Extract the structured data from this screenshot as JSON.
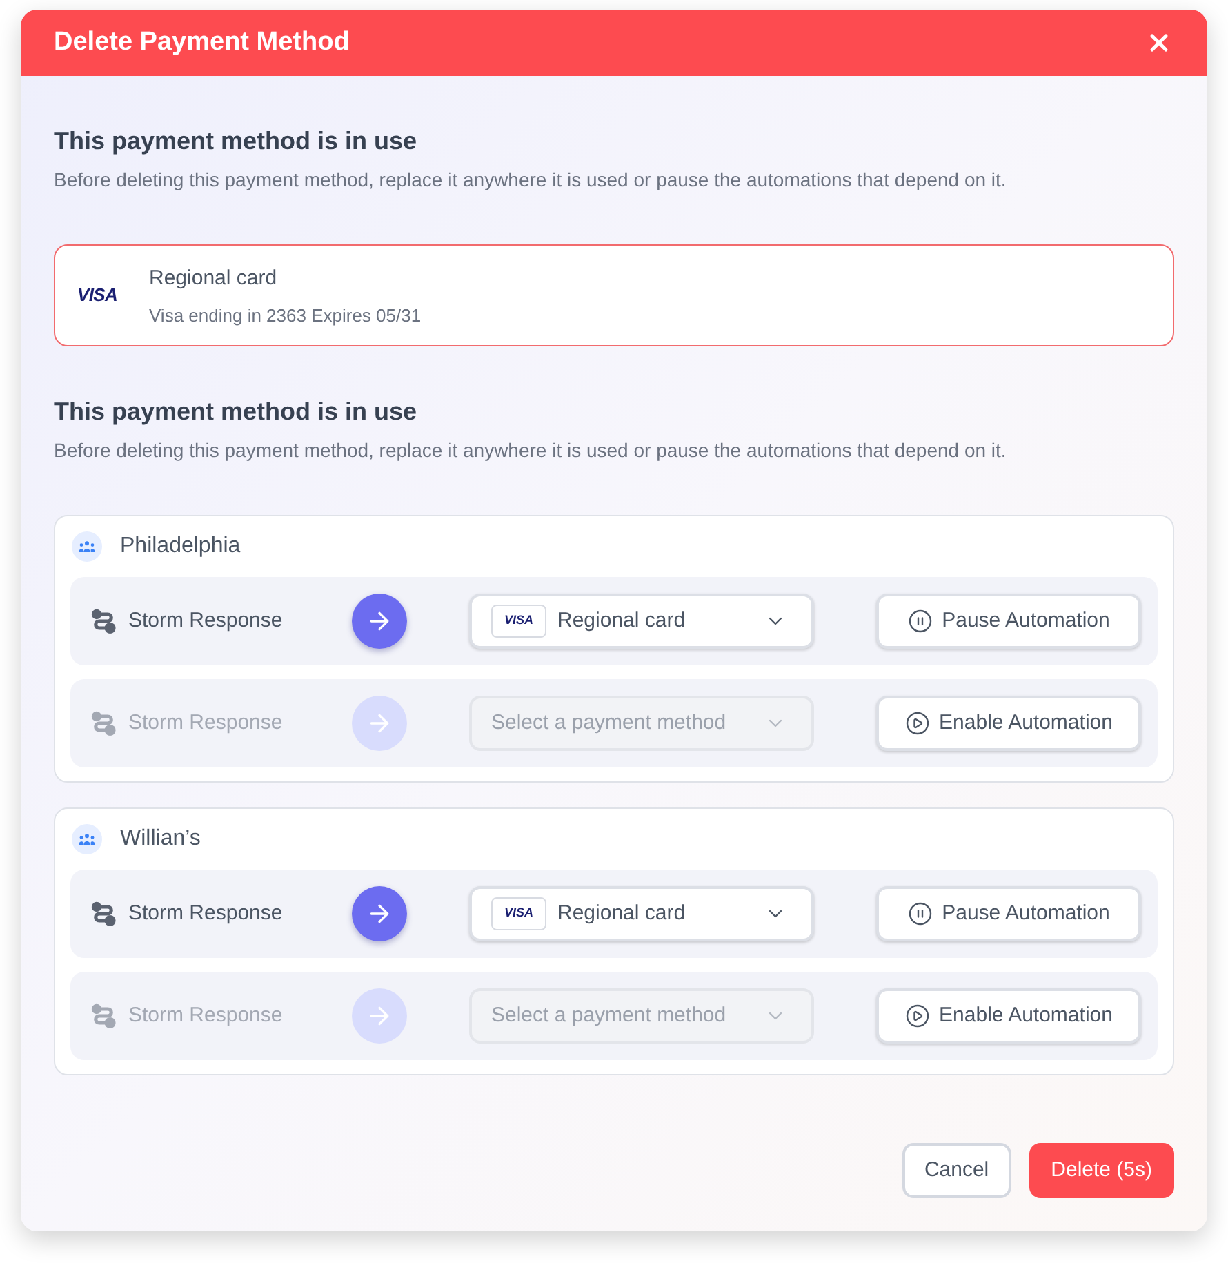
{
  "dialog": {
    "title": "Delete Payment Method"
  },
  "notice": {
    "heading": "This payment method is in use",
    "description": "Before deleting this payment method, replace it anywhere it is used or pause the automations that depend on it."
  },
  "payment_method": {
    "brand": "VISA",
    "name": "Regional card",
    "details": "Visa ending in 2363 Expires 05/31"
  },
  "replace_notice": {
    "heading": "This payment method is in use",
    "description": "Before deleting this payment method, replace it anywhere it is used or pause the automations that depend on it."
  },
  "groups": [
    {
      "name": "Philadelphia",
      "automations": [
        {
          "name": "Storm Response",
          "disabled": false,
          "select": {
            "brand": "VISA",
            "value": "Regional card"
          },
          "action": {
            "kind": "pause",
            "label": "Pause Automation"
          }
        },
        {
          "name": "Storm Response",
          "disabled": true,
          "select": {
            "placeholder": "Select a payment method"
          },
          "action": {
            "kind": "enable",
            "label": "Enable Automation"
          }
        }
      ]
    },
    {
      "name": "Willian’s",
      "automations": [
        {
          "name": "Storm Response",
          "disabled": false,
          "select": {
            "brand": "VISA",
            "value": "Regional card"
          },
          "action": {
            "kind": "pause",
            "label": "Pause Automation"
          }
        },
        {
          "name": "Storm Response",
          "disabled": true,
          "select": {
            "placeholder": "Select a payment method"
          },
          "action": {
            "kind": "enable",
            "label": "Enable Automation"
          }
        }
      ]
    }
  ],
  "buttons": [
    {
      "kind": "secondary",
      "label": "Cancel"
    },
    {
      "kind": "danger",
      "label": "Delete (5s)"
    }
  ]
}
